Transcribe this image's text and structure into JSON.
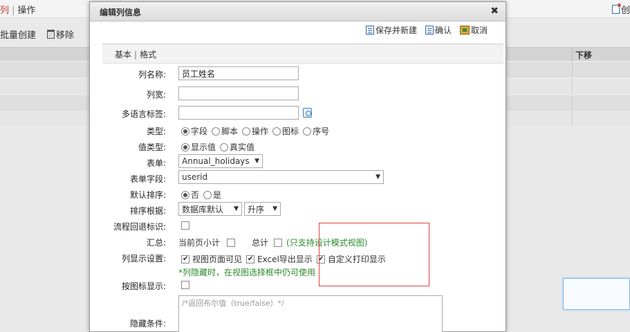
{
  "background": {
    "tab_active": "列",
    "tab_sep": "|",
    "tab_ops": "操作",
    "create_label": "创",
    "batch_create": "批量创建",
    "remove": "移除",
    "col_down": "下移"
  },
  "dialog": {
    "title": "编辑列信息",
    "close": "✖",
    "actions": {
      "save_new": "保存并新建",
      "confirm": "确认",
      "cancel": "取消"
    },
    "tabs": [
      "基本",
      "格式"
    ],
    "tab_sep": "|",
    "form": {
      "col_name_label": "列名称:",
      "col_name_value": "员工姓名",
      "col_width_label": "列宽:",
      "col_width_value": "",
      "i18n_label": "多语言标签:",
      "i18n_value": "",
      "type_label": "类型:",
      "type_options": [
        "字段",
        "脚本",
        "操作",
        "图标",
        "序号"
      ],
      "value_type_label": "值类型:",
      "value_type_options": [
        "显示值",
        "真实值"
      ],
      "form_label": "表单:",
      "form_value": "Annual_holidays",
      "form_field_label": "表单字段:",
      "form_field_value": "userid",
      "default_sort_label": "默认排序:",
      "default_sort_options": [
        "否",
        "是"
      ],
      "sort_by_label": "排序根据:",
      "sort_by_value": "数据库默认",
      "sort_order_value": "升序",
      "flow_back_label": "流程回退标识:",
      "summary_label": "汇总:",
      "summary_page_subtotal": "当前页小计",
      "summary_total": "总计",
      "summary_note": "(只支持设计模式视图)",
      "display_label": "列显示设置:",
      "display_view_visible": "视图页面可见",
      "display_excel": "Excel导出显示",
      "display_custom_print": "自定义打印显示",
      "display_note": "*列隐藏时，在视图选择框中仍可使用",
      "icon_display_label": "按图标显示:",
      "hidden_cond_label": "隐藏条件:",
      "hidden_cond_placeholder": "/*返回布尔值（true/false）*/"
    }
  }
}
